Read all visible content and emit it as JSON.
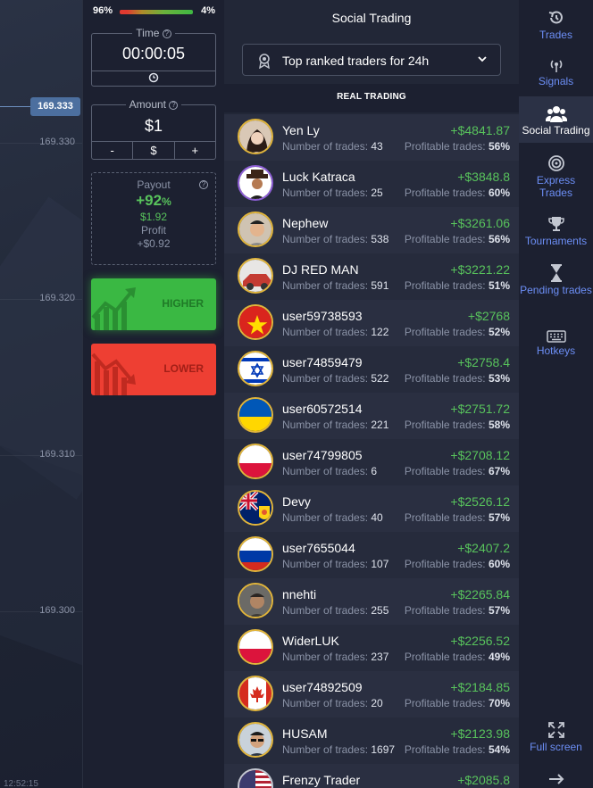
{
  "chart": {
    "current_price": "169.333",
    "price_labels": [
      "169.330",
      "169.320",
      "169.310",
      "169.300"
    ],
    "time_label": "12:52:15"
  },
  "trade": {
    "sentiment_left": "96%",
    "sentiment_right": "4%",
    "time_label": "Time",
    "time_value": "00:00:05",
    "amount_label": "Amount",
    "amount_value": "$1",
    "minus": "-",
    "currency": "$",
    "plus": "+",
    "payout_label": "Payout",
    "payout_pct": "+92",
    "payout_pct_sign": "%",
    "payout_value": "$1.92",
    "profit_label": "Profit",
    "profit_value": "+$0.92",
    "higher_label": "HIGHER",
    "lower_label": "LOWER"
  },
  "social": {
    "title": "Social Trading",
    "dropdown_value": "Top ranked traders for 24h",
    "section_header": "REAL TRADING",
    "trades_prefix": "Number of trades: ",
    "profitable_prefix": "Profitable trades: ",
    "traders": [
      {
        "name": "Yen Ly",
        "trades": "43",
        "profit": "+$4841.87",
        "profitable": "56%",
        "avatar": "photo-woman"
      },
      {
        "name": "Luck Katraca",
        "trades": "25",
        "profit": "+$3848.8",
        "profitable": "60%",
        "avatar": "photo-man-hat"
      },
      {
        "name": "Nephew",
        "trades": "538",
        "profit": "+$3261.06",
        "profitable": "56%",
        "avatar": "photo-man"
      },
      {
        "name": "DJ RED MAN",
        "trades": "591",
        "profit": "+$3221.22",
        "profitable": "51%",
        "avatar": "photo-car"
      },
      {
        "name": "user59738593",
        "trades": "122",
        "profit": "+$2768",
        "profitable": "52%",
        "avatar": "flag-vietnam"
      },
      {
        "name": "user74859479",
        "trades": "522",
        "profit": "+$2758.4",
        "profitable": "53%",
        "avatar": "flag-israel"
      },
      {
        "name": "user60572514",
        "trades": "221",
        "profit": "+$2751.72",
        "profitable": "58%",
        "avatar": "flag-ukraine"
      },
      {
        "name": "user74799805",
        "trades": "6",
        "profit": "+$2708.12",
        "profitable": "67%",
        "avatar": "flag-poland"
      },
      {
        "name": "Devy",
        "trades": "40",
        "profit": "+$2526.12",
        "profitable": "57%",
        "avatar": "flag-turks-caicos"
      },
      {
        "name": "user7655044",
        "trades": "107",
        "profit": "+$2407.2",
        "profitable": "60%",
        "avatar": "flag-russia"
      },
      {
        "name": "nnehti",
        "trades": "255",
        "profit": "+$2265.84",
        "profitable": "57%",
        "avatar": "photo-man-dark"
      },
      {
        "name": "WiderLUK",
        "trades": "237",
        "profit": "+$2256.52",
        "profitable": "49%",
        "avatar": "flag-poland"
      },
      {
        "name": "user74892509",
        "trades": "20",
        "profit": "+$2184.85",
        "profitable": "70%",
        "avatar": "flag-canada"
      },
      {
        "name": "HUSAM",
        "trades": "1697",
        "profit": "+$2123.98",
        "profitable": "54%",
        "avatar": "photo-man-sunglasses"
      },
      {
        "name": "Frenzy Trader",
        "trades": "",
        "profit": "+$2085.8",
        "profitable": "",
        "avatar": "flag-usa"
      }
    ]
  },
  "nav": {
    "trades": "Trades",
    "signals": "Signals",
    "social_trading": "Social Trading",
    "express_trades": "Express Trades",
    "tournaments": "Tournaments",
    "pending_trades": "Pending trades",
    "hotkeys": "Hotkeys",
    "full_screen": "Full screen"
  },
  "colors": {
    "accent": "#6c8ef5",
    "profit_green": "#58c35c",
    "higher_green": "#3ab843",
    "lower_red": "#ee3f33",
    "price_tag": "#4c6f9f"
  }
}
